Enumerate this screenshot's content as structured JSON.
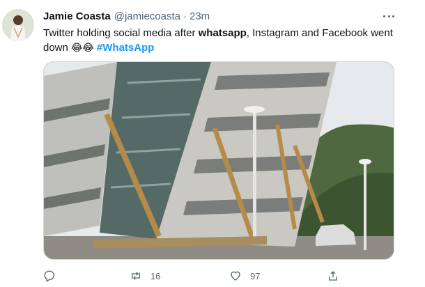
{
  "tweet": {
    "display_name": "Jamie Coasta",
    "handle": "@jamiecoasta",
    "separator": "·",
    "time": "23m",
    "text_part1": "Twitter holding social media after ",
    "text_bold": "whatsapp",
    "text_part2": ", Instagram and Facebook went down ",
    "emojis": "😂😂",
    "hashtag": "#WhatsApp",
    "media_icon": "photo-collapsed-buildings"
  },
  "actions": {
    "reply_count": "",
    "retweet_count": "16",
    "like_count": "97",
    "share_count": ""
  },
  "colors": {
    "accent": "#1d9bf0",
    "secondary_text": "#536471",
    "primary_text": "#0f1419"
  }
}
